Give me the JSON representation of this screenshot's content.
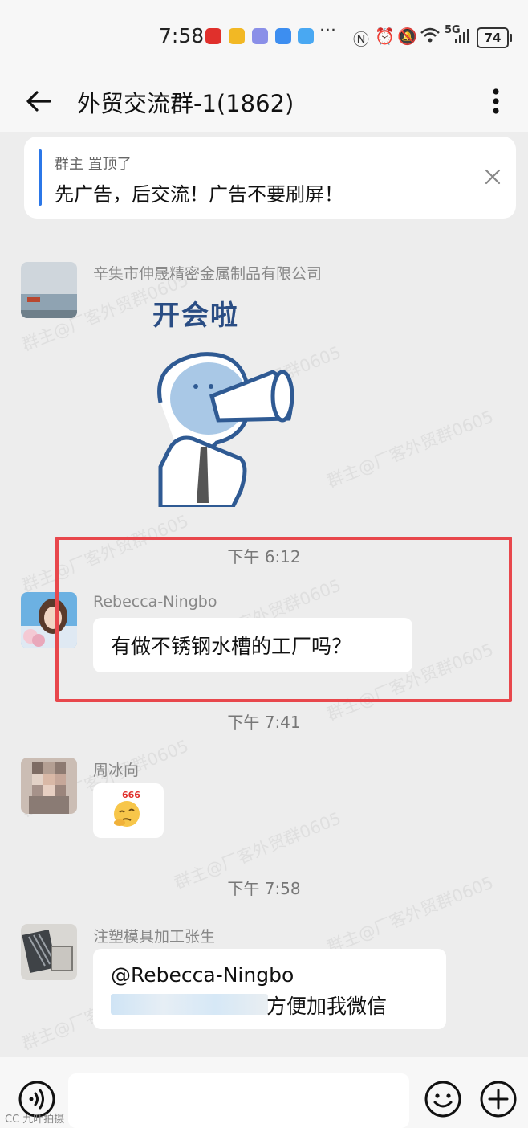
{
  "status_bar": {
    "time": "7:58",
    "battery": "74",
    "network": "5G",
    "more_dots": "···"
  },
  "header": {
    "title": "外贸交流群-1(1862)"
  },
  "pinned": {
    "meta": "群主 置顶了",
    "text": "先广告，后交流！广告不要刷屏！"
  },
  "messages": [
    {
      "sender": "辛集市伸晟精密金属制品有限公司",
      "sticker_text": "开会啦"
    },
    {
      "time": "下午 6:12",
      "sender": "Rebecca-Ningbo",
      "text": "有做不锈钢水槽的工厂吗？"
    },
    {
      "time": "下午 7:41",
      "sender": "周冰向",
      "emoji_badge": "666"
    },
    {
      "time": "下午 7:58",
      "sender": "注塑模具加工张生",
      "line1": "@Rebecca-Ningbo",
      "line2_visible": "方便加我微信"
    }
  ],
  "watermark_text": "群主@厂客外贸群0605",
  "bottom_corner": "CC 九叶拍摄",
  "colors": {
    "accent_blue": "#2b77e8",
    "highlight_red": "#e8474c",
    "chat_bg": "#ededed"
  }
}
